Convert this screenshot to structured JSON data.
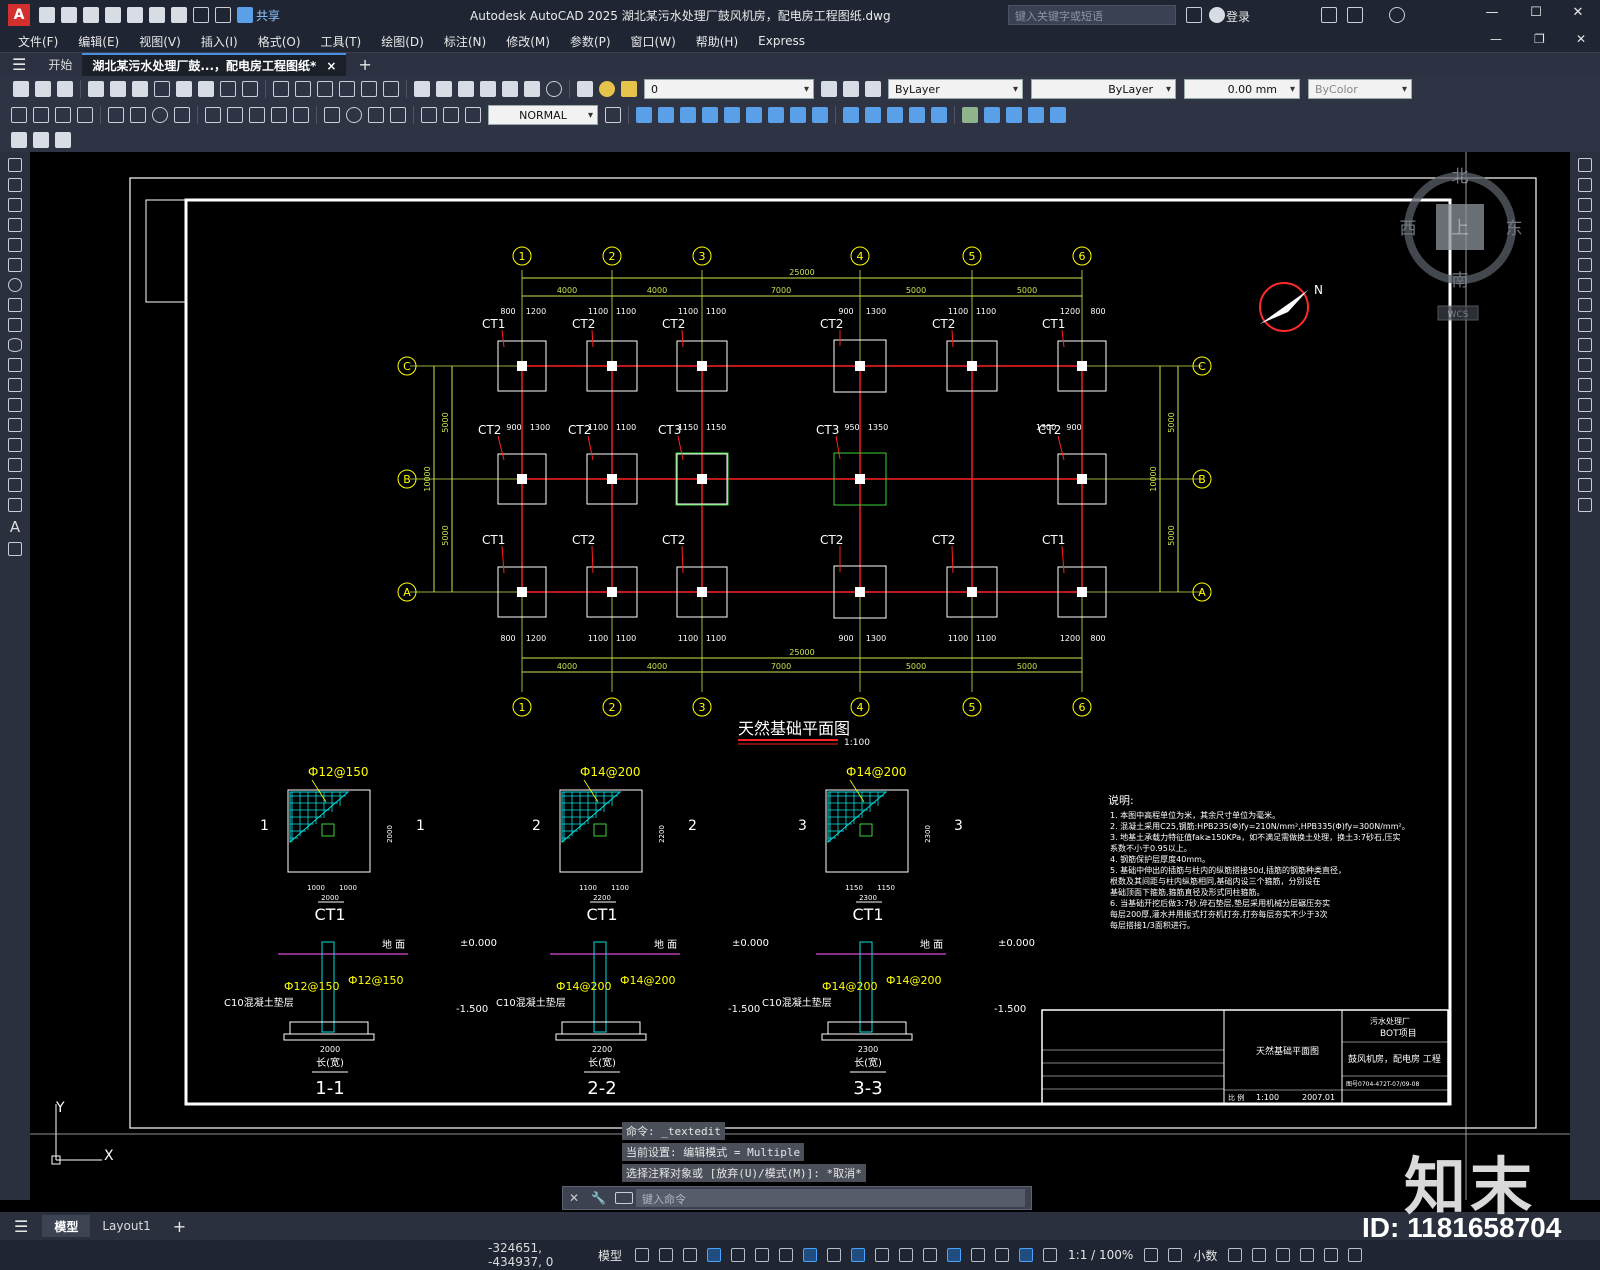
{
  "app": {
    "logo_letter": "A",
    "title": "Autodesk AutoCAD 2025    湖北某污水处理厂鼓风机房，配电房工程图纸.dwg",
    "share_label": "共享",
    "search_placeholder": "键入关键字或短语",
    "login_label": "登录"
  },
  "menu": [
    "文件(F)",
    "编辑(E)",
    "视图(V)",
    "插入(I)",
    "格式(O)",
    "工具(T)",
    "绘图(D)",
    "标注(N)",
    "修改(M)",
    "参数(P)",
    "窗口(W)",
    "帮助(H)",
    "Express"
  ],
  "tabs": {
    "start": "开始",
    "active": "湖北某污水处理厂鼓...，配电房工程图纸*",
    "close": "×",
    "add": "+"
  },
  "toolbar": {
    "layer_value": "0",
    "color_value": "ByLayer",
    "linetype_value": "ByLayer",
    "lineweight_value": "0.00 mm",
    "plotstyle_value": "ByColor",
    "dimstyle_value": "NORMAL"
  },
  "viewcube": {
    "north": "北",
    "south": "南",
    "east": "东",
    "west": "西",
    "top": "上",
    "wcs": "WCS"
  },
  "drawing": {
    "plan_title": "天然基础平面图",
    "plan_scale": "1:100",
    "grid_cols": [
      "1",
      "2",
      "3",
      "4",
      "5",
      "6"
    ],
    "grid_rows": [
      "C",
      "B",
      "A"
    ],
    "total_dim": "25000",
    "span_dims": [
      "4000",
      "4000",
      "7000",
      "5000",
      "5000"
    ],
    "row_dims": [
      "5000",
      "5000"
    ],
    "total_row_dim": "10000",
    "top_offsets": [
      "800",
      "1200",
      "1100",
      "1100",
      "1100",
      "1100",
      "900",
      "1300",
      "1100",
      "1100",
      "1200",
      "800"
    ],
    "mid_offsets": [
      "900",
      "1300",
      "1100",
      "1100",
      "1150",
      "1150",
      "950",
      "1350",
      "1300",
      "900"
    ],
    "foot_top": [
      "CT1",
      "CT2",
      "CT2",
      "CT2",
      "CT2",
      "CT1"
    ],
    "foot_mid": [
      "CT2",
      "CT2",
      "CT3",
      "CT3",
      "CT2"
    ],
    "foot_bot": [
      "CT1",
      "CT2",
      "CT2",
      "CT2",
      "CT2",
      "CT1"
    ],
    "details": [
      {
        "name": "CT1",
        "rebar": "Ф12@150",
        "mark": "1",
        "size": "2000",
        "half": "1000",
        "section": "1-1",
        "rebar_a": "Ф12@150",
        "rebar_b": "Ф12@150"
      },
      {
        "name": "CT1",
        "rebar": "Ф14@200",
        "mark": "2",
        "size": "2200",
        "half": "1100",
        "section": "2-2",
        "rebar_a": "Ф14@200",
        "rebar_b": "Ф14@200"
      },
      {
        "name": "CT1",
        "rebar": "Ф14@200",
        "mark": "3",
        "size": "2300",
        "half": "1150",
        "section": "3-3",
        "rebar_a": "Ф14@200",
        "rebar_b": "Ф14@200"
      }
    ],
    "section_labels": {
      "ground": "地 面",
      "level0": "±0.000",
      "level1": "-1.500",
      "pad": "C10混凝土垫层",
      "width": "长(宽)"
    },
    "notes_title": "说明:",
    "notes": [
      "1. 本图中高程单位为米，其余尺寸单位为毫米。",
      "2. 混凝土采用C25,钢筋:HPB235(Φ)fy=210N/mm²,HPB335(Φ)fy=300N/mm²。",
      "3. 地基土承载力特征值fak≥150KPa，如不满足需做换土处理，换土3:7砂石,压实",
      "   系数不小于0.95以上。",
      "4. 钢筋保护层厚度40mm。",
      "5. 基础中伸出的插筋与柱内的纵筋搭接50d,插筋的钢筋种类直径，",
      "   根数及其间距与柱内纵筋相同,基础内设三个箍筋，分别设在",
      "   基础顶面下箍筋,箍筋直径及形式同柱箍筋。",
      "6. 当基础开挖后做3:7砂,碎石垫层,垫层采用机械分层碾压夯实",
      "   每层200厚,灌水并用振式打夯机打夯,打夯每层夯实不少于3次",
      "   每层搭接1/3面积进行。"
    ],
    "titleblock": {
      "owner": "污水处理厂",
      "project_tag": "BOT项目",
      "drawing_name": "天然基础平面图",
      "project": "鼓风机房，配电房 工程",
      "drawing_no": "图号0704-472T-07/09-08",
      "scale_label": "比 例",
      "scale": "1:100",
      "date": "2007.01"
    }
  },
  "command": {
    "lines": [
      "命令:  _textedit",
      "当前设置: 编辑模式 = Multiple",
      "选择注释对象或 [放弃(U)/模式(M)]: *取消*"
    ],
    "placeholder": "键入命令"
  },
  "layout_tabs": [
    "模型",
    "Layout1"
  ],
  "status": {
    "coords": "-324651, -434937, 0",
    "model": "模型",
    "scale": "1:1 / 100%",
    "units": "小数"
  },
  "watermark": {
    "brand": "知末",
    "id": "ID: 1181658704"
  },
  "colors": {
    "grid_line": "#ff2020",
    "dim": "#c8e64c",
    "footing": "#ffffff",
    "grid_bubble": "#ffff00",
    "hatch": "#00e0e0",
    "canvas": "#000000"
  }
}
